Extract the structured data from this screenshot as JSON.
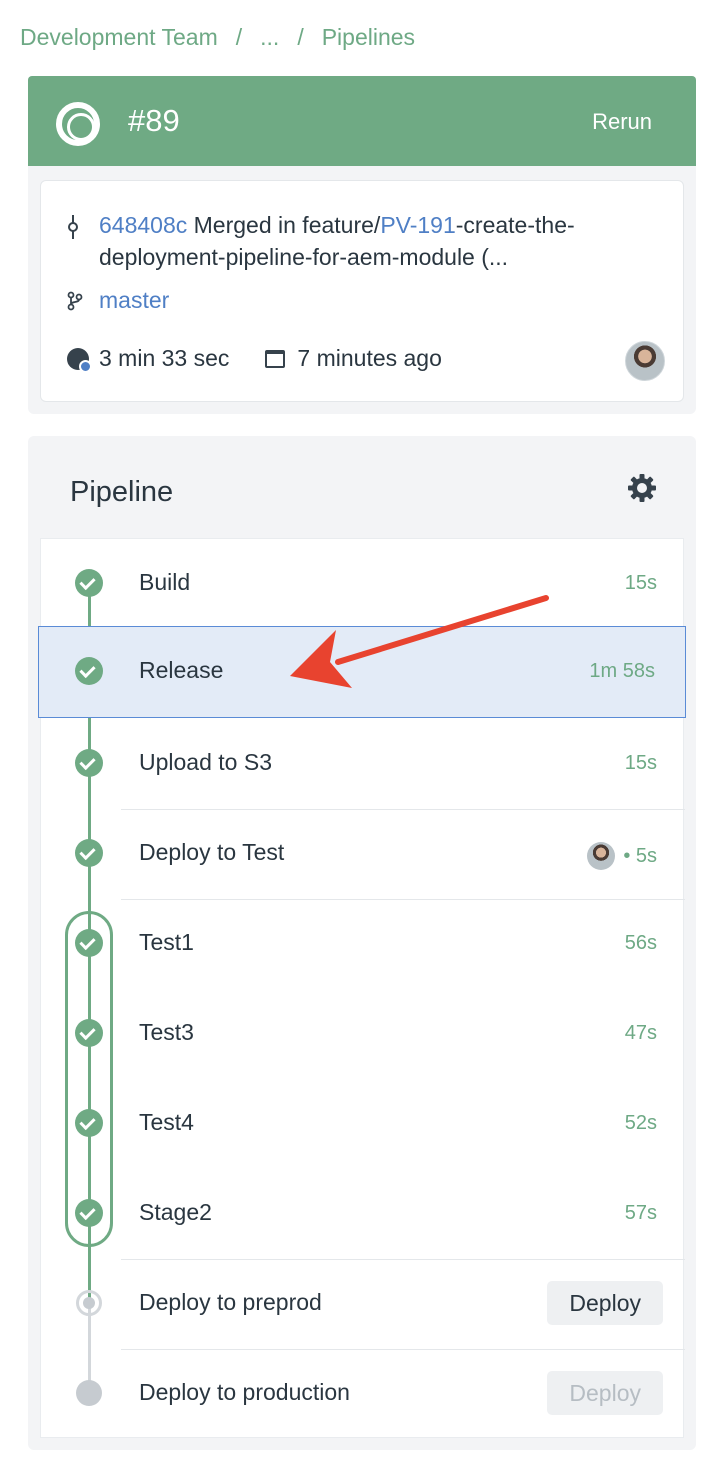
{
  "breadcrumb": {
    "items": [
      "Development Team",
      "...",
      "Pipelines"
    ],
    "separator": "/"
  },
  "header": {
    "run_number": "#89",
    "rerun_label": "Rerun",
    "status_color": "#6faa84"
  },
  "commit": {
    "hash": "648408c",
    "message_prefix": " Merged in feature/",
    "issue_key": "PV-191",
    "message_suffix": "-create-the-deployment-pipeline-for-aem-module (...",
    "branch": "master",
    "duration": "3 min 33 sec",
    "time_ago": "7 minutes ago"
  },
  "pipeline": {
    "title": "Pipeline",
    "steps": [
      {
        "name": "Build",
        "duration": "15s",
        "status": "success"
      },
      {
        "name": "Release",
        "duration": "1m 58s",
        "status": "success",
        "selected": true
      },
      {
        "name": "Upload to S3",
        "duration": "15s",
        "status": "success"
      },
      {
        "name": "Deploy to Test",
        "duration": "• 5s",
        "status": "success",
        "has_avatar": true
      },
      {
        "name": "Test1",
        "duration": "56s",
        "status": "success"
      },
      {
        "name": "Test3",
        "duration": "47s",
        "status": "success"
      },
      {
        "name": "Test4",
        "duration": "52s",
        "status": "success"
      },
      {
        "name": "Stage2",
        "duration": "57s",
        "status": "success"
      },
      {
        "name": "Deploy to preprod",
        "status": "pending",
        "button": "Deploy"
      },
      {
        "name": "Deploy to production",
        "status": "blocked",
        "button": "Deploy"
      }
    ]
  },
  "colors": {
    "success": "#6faa84",
    "link": "#4f7fc5",
    "selected_bg": "#e3ebf7",
    "annotation_arrow": "#e8432f"
  }
}
